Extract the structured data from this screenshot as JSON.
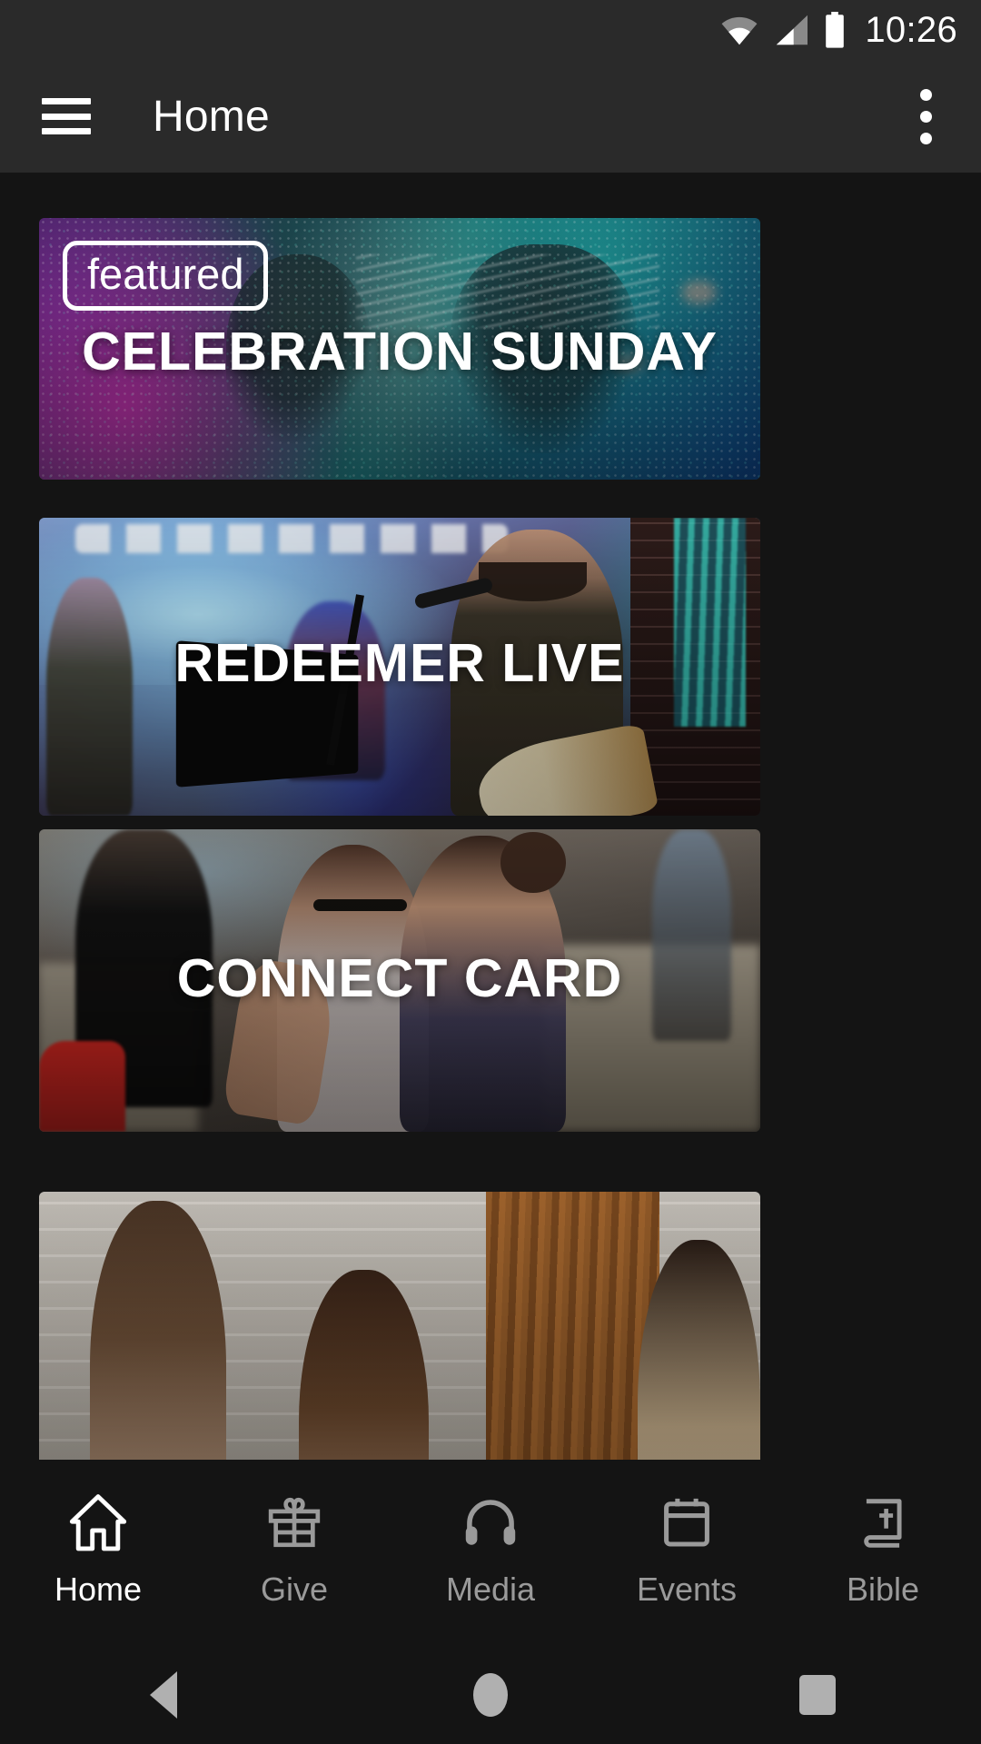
{
  "status_bar": {
    "time": "10:26",
    "icons": [
      "wifi-icon",
      "cellular-signal-icon",
      "battery-icon"
    ]
  },
  "app_bar": {
    "menu_icon": "hamburger-menu-icon",
    "title": "Home",
    "overflow_icon": "overflow-menu-icon"
  },
  "feed": {
    "cards": [
      {
        "title": "CELEBRATION SUNDAY",
        "badge": "featured",
        "has_badge": true
      },
      {
        "title": "REDEEMER LIVE",
        "badge": "",
        "has_badge": false
      },
      {
        "title": "CONNECT CARD",
        "badge": "",
        "has_badge": false
      },
      {
        "title": "",
        "badge": "",
        "has_badge": false
      }
    ]
  },
  "bottom_nav": {
    "active_index": 0,
    "items": [
      {
        "label": "Home",
        "icon": "home-icon"
      },
      {
        "label": "Give",
        "icon": "gift-icon"
      },
      {
        "label": "Media",
        "icon": "headphones-icon"
      },
      {
        "label": "Events",
        "icon": "calendar-icon"
      },
      {
        "label": "Bible",
        "icon": "bible-book-icon"
      }
    ]
  },
  "system_nav": {
    "back": "back-triangle-icon",
    "home": "home-circle-icon",
    "recents": "recents-square-icon"
  },
  "colors": {
    "app_bar_bg": "#2a2a2a",
    "body_bg": "#141414",
    "active_label": "#ffffff",
    "inactive_label": "#9a9a9a",
    "system_nav_icon": "#b0b0b0"
  }
}
